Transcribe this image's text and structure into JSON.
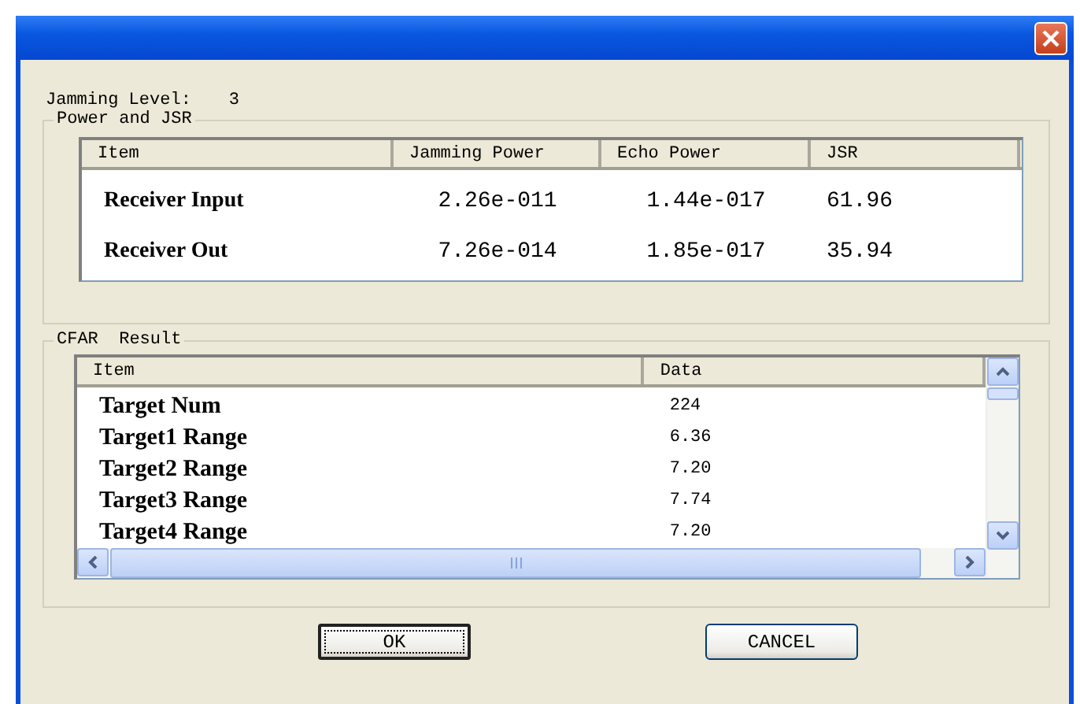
{
  "jamming_level": {
    "label": "Jamming Level:",
    "value": "3"
  },
  "power_group": {
    "title": "Power and JSR",
    "columns": [
      "Item",
      "Jamming Power",
      "Echo Power",
      "JSR"
    ],
    "rows": [
      {
        "cells": [
          "Receiver Input",
          "2.26e-011",
          "1.44e-017",
          "61.96"
        ]
      },
      {
        "cells": [
          "Receiver Out",
          "7.26e-014",
          "1.85e-017",
          "35.94"
        ]
      }
    ]
  },
  "cfar_group": {
    "title": "CFAR  Result",
    "columns": [
      "Item",
      "Data"
    ],
    "rows": [
      {
        "cells": [
          "Target Num",
          "224"
        ]
      },
      {
        "cells": [
          "Target1 Range",
          "6.36"
        ]
      },
      {
        "cells": [
          "Target2 Range",
          "7.20"
        ]
      },
      {
        "cells": [
          "Target3 Range",
          "7.74"
        ]
      },
      {
        "cells": [
          "Target4 Range",
          "7.20"
        ]
      }
    ]
  },
  "buttons": [
    {
      "label": "OK",
      "focused": true
    },
    {
      "label": "CANCEL",
      "focused": false
    }
  ]
}
